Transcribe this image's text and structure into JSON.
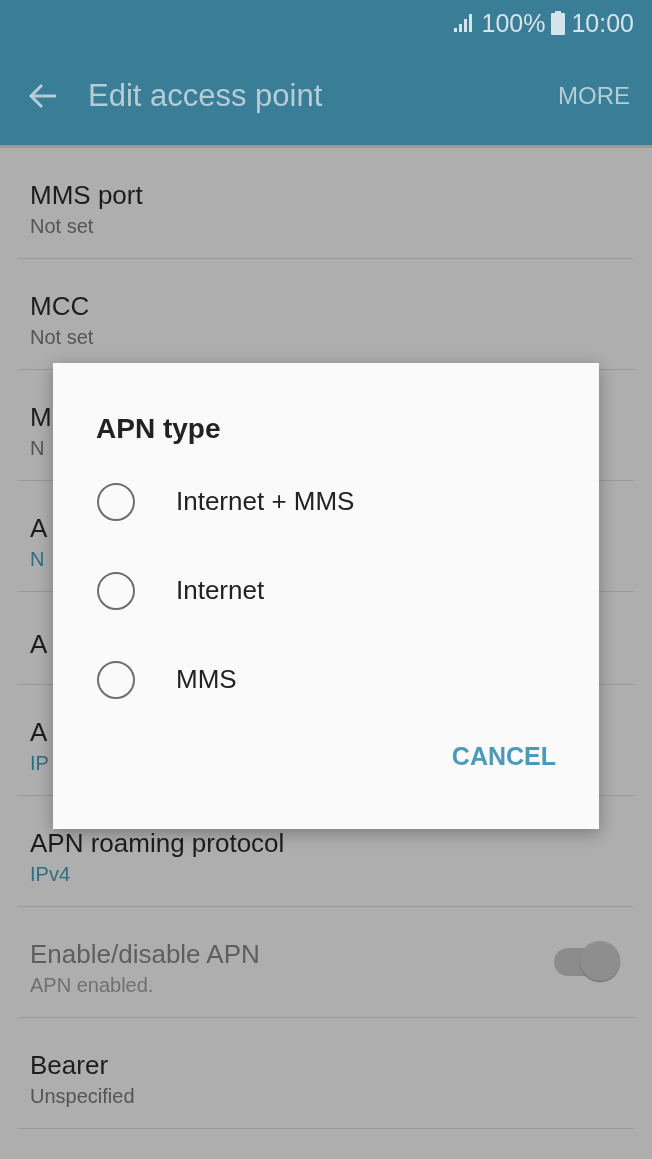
{
  "status_bar": {
    "battery": "100%",
    "time": "10:00"
  },
  "app_bar": {
    "title": "Edit access point",
    "action": "MORE"
  },
  "settings": [
    {
      "kind": "text",
      "title": "MMS port",
      "value": "Not set",
      "value_accent": false
    },
    {
      "kind": "text",
      "title": "MCC",
      "value": "Not set",
      "value_accent": false
    },
    {
      "kind": "text",
      "title": "M",
      "value": "N",
      "value_accent": false
    },
    {
      "kind": "text",
      "title": "A",
      "value": "N",
      "value_accent": true
    },
    {
      "kind": "text",
      "title": "A"
    },
    {
      "kind": "text",
      "title": "A",
      "value": "IP",
      "value_accent": true
    },
    {
      "kind": "text",
      "title": "APN roaming protocol",
      "value": "IPv4",
      "value_accent": true
    },
    {
      "kind": "toggle",
      "title": "Enable/disable APN",
      "value": "APN enabled.",
      "disabled": true,
      "on": true
    },
    {
      "kind": "text",
      "title": "Bearer",
      "value": "Unspecified",
      "value_accent": false
    }
  ],
  "dialog": {
    "title": "APN type",
    "options": [
      {
        "label": "Internet + MMS",
        "selected": false
      },
      {
        "label": "Internet",
        "selected": false
      },
      {
        "label": "MMS",
        "selected": false
      }
    ],
    "cancel": "CANCEL"
  }
}
